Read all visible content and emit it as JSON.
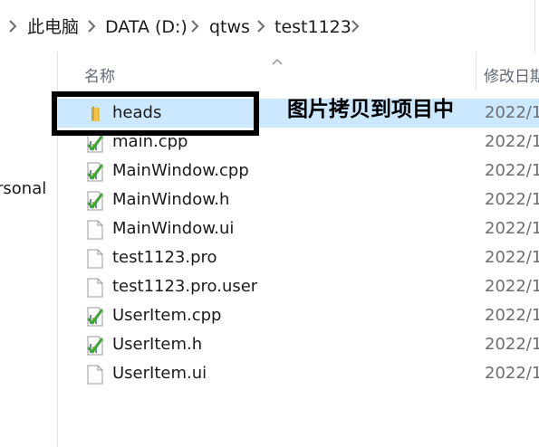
{
  "breadcrumb": {
    "items": [
      "此电脑",
      "DATA (D:)",
      "qtws",
      "test1123"
    ]
  },
  "nav": {
    "partial_label": "rsonal"
  },
  "columns": {
    "name": "名称",
    "date_modified": "修改日期"
  },
  "files": [
    {
      "name": "heads",
      "type": "folder",
      "date": "2022/1",
      "selected": true
    },
    {
      "name": "main.cpp",
      "type": "cpp",
      "date": "2022/1"
    },
    {
      "name": "MainWindow.cpp",
      "type": "cpp",
      "date": "2022/1"
    },
    {
      "name": "MainWindow.h",
      "type": "cpp",
      "date": "2022/1"
    },
    {
      "name": "MainWindow.ui",
      "type": "file",
      "date": "2022/1"
    },
    {
      "name": "test1123.pro",
      "type": "file",
      "date": "2022/1"
    },
    {
      "name": "test1123.pro.user",
      "type": "file",
      "date": "2022/1"
    },
    {
      "name": "UserItem.cpp",
      "type": "cpp",
      "date": "2022/1"
    },
    {
      "name": "UserItem.h",
      "type": "cpp",
      "date": "2022/1"
    },
    {
      "name": "UserItem.ui",
      "type": "file",
      "date": "2022/1"
    }
  ],
  "annotation": {
    "text": "图片拷贝到项目中"
  },
  "colors": {
    "selection": "#cce8ff",
    "folder": "#f0c54a",
    "text": "#1b1b1b",
    "header_text": "#5f6b7a",
    "date_text": "#6d6d6d"
  }
}
